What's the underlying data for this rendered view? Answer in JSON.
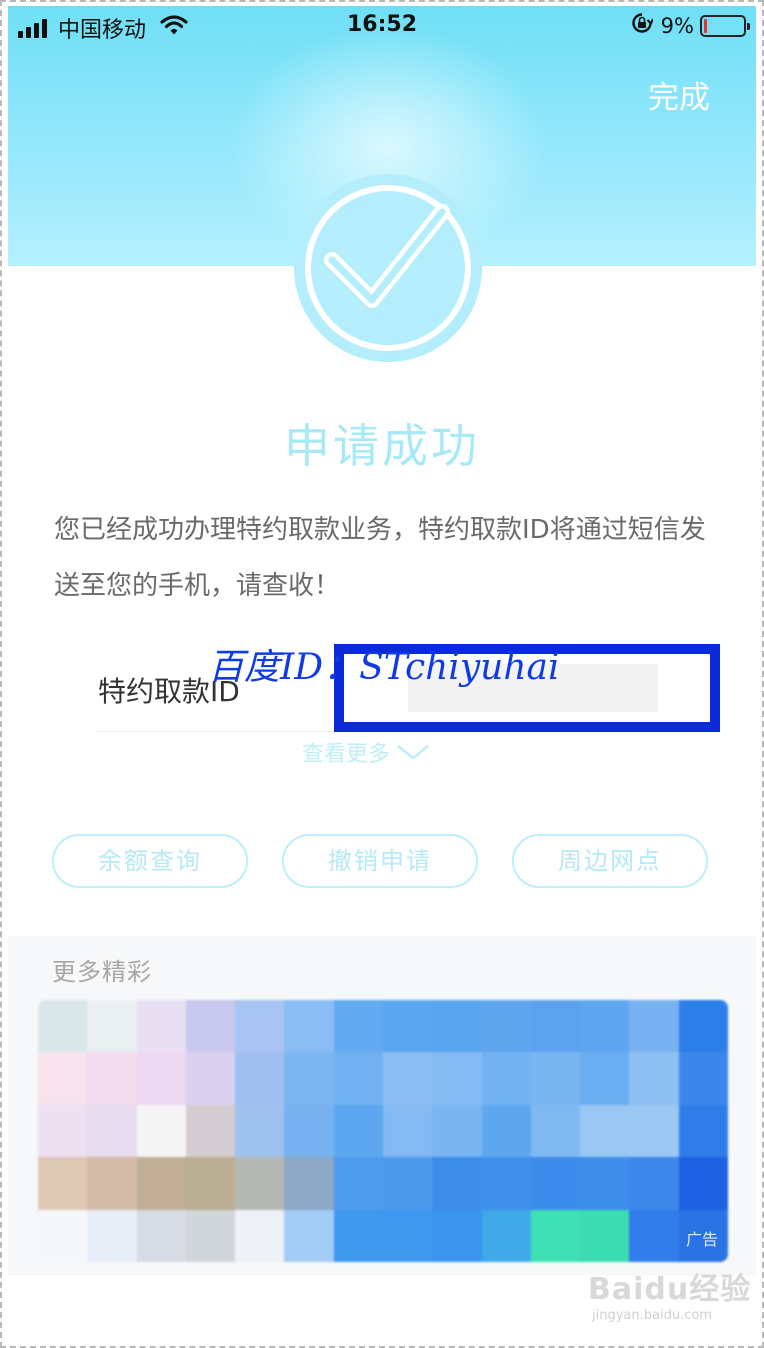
{
  "status_bar": {
    "carrier": "中国移动",
    "time": "16:52",
    "battery_percent": "9%",
    "battery_level": 0.09,
    "icons": [
      "signal-icon",
      "wifi-icon",
      "rotation-lock-icon",
      "battery-icon"
    ]
  },
  "header": {
    "done_label": "完成"
  },
  "result": {
    "icon": "check-circle-icon",
    "title": "申请成功",
    "description": "您已经成功办理特约取款业务，特约取款ID将通过短信发送至您的手机，请查收！"
  },
  "id_row": {
    "label": "特约取款ID"
  },
  "watermark": {
    "text": "百度ID：STchiyuhai",
    "color": "#0a2ad8"
  },
  "more": {
    "label": "查看更多",
    "icon": "chevron-down-icon"
  },
  "actions": [
    {
      "label": "余额查询"
    },
    {
      "label": "撤销申请"
    },
    {
      "label": "周边网点"
    }
  ],
  "promo": {
    "title": "更多精彩",
    "ad_tag": "广告"
  },
  "site_mark": {
    "brand": "Baidu经验",
    "url": "jingyan.baidu.com"
  },
  "colors": {
    "accent": "#a8e9f7",
    "header_gradient_top": "#6fdff5",
    "watermark_blue": "#0a2ad8"
  }
}
